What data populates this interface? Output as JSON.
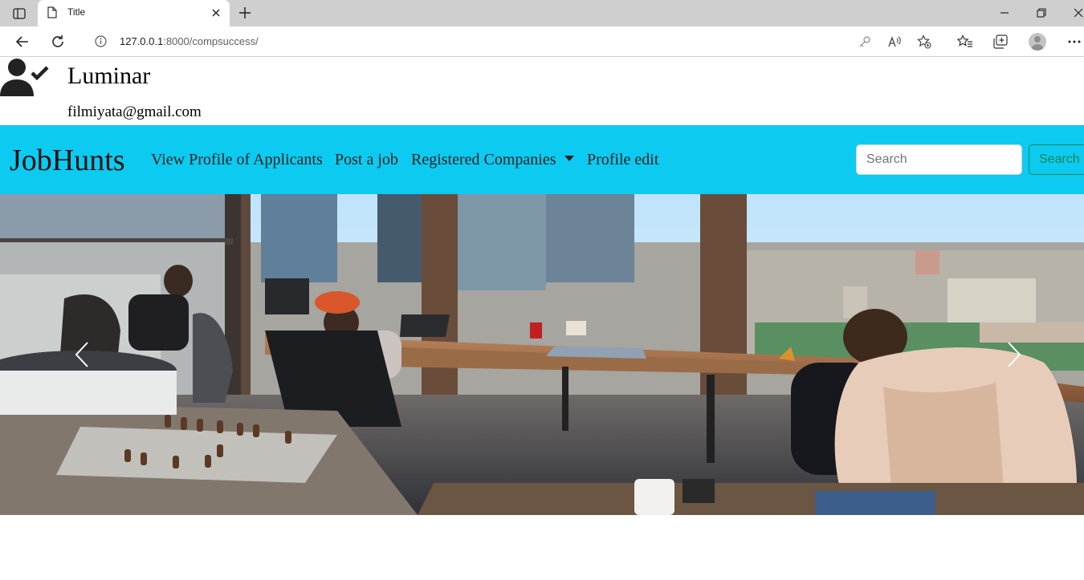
{
  "browser": {
    "tab_title": "Title",
    "url_host": "127.0.0.1",
    "url_rest": ":8000/compsuccess/"
  },
  "user": {
    "name": "Luminar",
    "email": "filmiyata@gmail.com"
  },
  "navbar": {
    "brand": "JobHunts",
    "links": [
      "View Profile of Applicants",
      "Post a job",
      "Registered Companies",
      "Profile edit"
    ],
    "search_placeholder": "Search",
    "search_button": "Search",
    "background_color": "#0dcaf0"
  }
}
